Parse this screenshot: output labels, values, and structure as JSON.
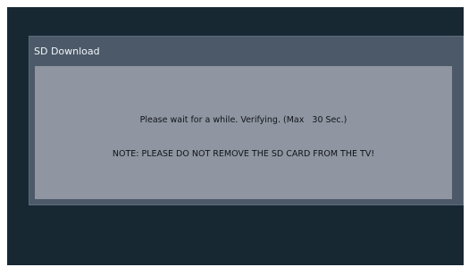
{
  "dialog": {
    "title": "SD Download",
    "message": "Please wait for a while. Verifying. (Max   30 Sec.)",
    "note": "NOTE: PLEASE DO NOT REMOVE THE SD CARD FROM THE TV!"
  },
  "colors": {
    "screen_background": "#172833",
    "dialog_frame": "#4b5969",
    "dialog_body": "#8f95a1",
    "title_text": "#f2f4f6",
    "body_text": "#111418"
  }
}
